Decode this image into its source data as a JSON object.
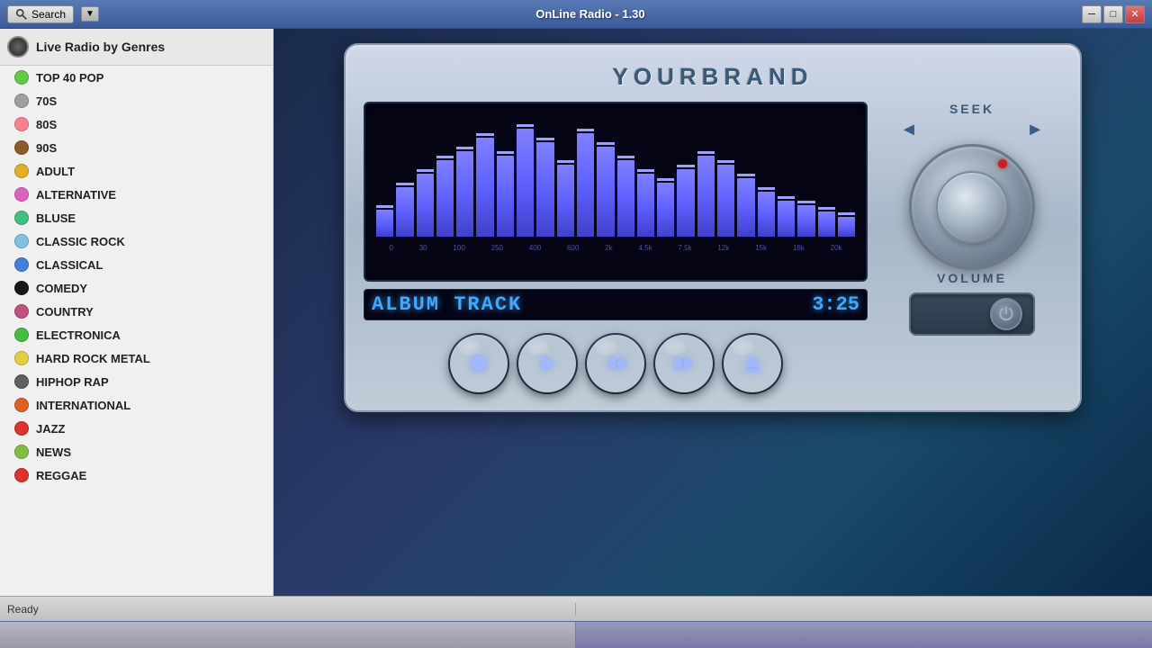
{
  "titlebar": {
    "title": "OnLine Radio - 1.30",
    "search_label": "Search",
    "window_controls": {
      "minimize": "─",
      "restore": "□",
      "close": "✕"
    }
  },
  "sidebar": {
    "header": "Live Radio by Genres",
    "genres": [
      {
        "name": "TOP 40 POP",
        "color": "#60cc40"
      },
      {
        "name": "70S",
        "color": "#a0a0a0"
      },
      {
        "name": "80S",
        "color": "#ff8090"
      },
      {
        "name": "90S",
        "color": "#8b5a2b"
      },
      {
        "name": "ADULT",
        "color": "#e0b020"
      },
      {
        "name": "ALTERNATIVE",
        "color": "#e060c0"
      },
      {
        "name": "BLUSE",
        "color": "#40c080"
      },
      {
        "name": "CLASSIC ROCK",
        "color": "#80c0e0"
      },
      {
        "name": "CLASSICAL",
        "color": "#4080e0"
      },
      {
        "name": "COMEDY",
        "color": "#181818"
      },
      {
        "name": "COUNTRY",
        "color": "#c05080"
      },
      {
        "name": "ELECTRONICA",
        "color": "#40c040"
      },
      {
        "name": "HARD ROCK METAL",
        "color": "#e0d040"
      },
      {
        "name": "HIPHOP RAP",
        "color": "#606060"
      },
      {
        "name": "INTERNATIONAL",
        "color": "#e06020"
      },
      {
        "name": "JAZZ",
        "color": "#e03030"
      },
      {
        "name": "NEWS",
        "color": "#80c040"
      },
      {
        "name": "REGGAE",
        "color": "#e03030"
      }
    ]
  },
  "player": {
    "brand": "YOURBRAND",
    "seek_label": "SEEK",
    "volume_label": "VOLUME",
    "track_name": "ALBUM TRACK",
    "track_time": "3:25",
    "eq_labels": [
      "0",
      "30",
      "100",
      "250",
      "400",
      "600",
      "2k",
      "4.5k",
      "7.5k",
      "12k",
      "15k",
      "18k",
      "20k"
    ]
  },
  "controls": {
    "stop": "stop",
    "play": "play",
    "rewind": "rewind",
    "fast_forward": "fast-forward",
    "eject": "eject"
  },
  "status": {
    "text": "Ready",
    "right": ""
  }
}
